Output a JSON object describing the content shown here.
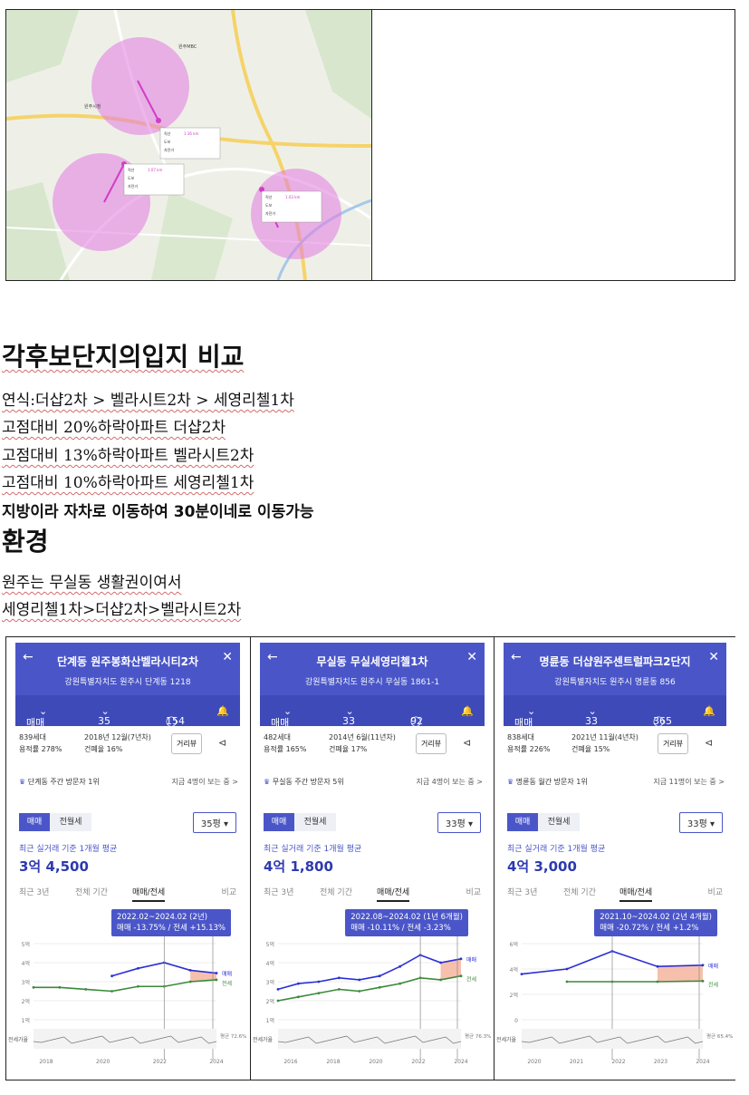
{
  "map": {
    "labels": {
      "city_hall": "원주시청",
      "mbc": "원주MBC",
      "popup": {
        "straight_label": "직선",
        "walk_label": "도보",
        "bike_label": "자전거"
      },
      "distances": [
        "1.36 km",
        "1.07 km",
        "1.03 km"
      ]
    },
    "colors": {
      "circle": "#e27ae0",
      "route": "#d23cc6",
      "road": "#f6d36a",
      "water": "#a6c8e8"
    }
  },
  "section1": {
    "heading": "각후보단지의입지 비교",
    "lines": [
      "연식:더샵2차 > 벨라시트2차 > 세영리첼1차",
      "고점대비 20%하락아파트 더샵2차",
      "고점대비 13%하락아파트 벨라시트2차",
      "고점대비 10%하락아파트 세영리첼1차"
    ],
    "bold_line": "지방이라 자차로 이동하여 30분이네로 이동가능"
  },
  "section2": {
    "heading": "환경",
    "lines": [
      "원주는 무실동 생활권이여서",
      "세영리첼1차>더샵2차>벨라시트2차"
    ]
  },
  "panels": [
    {
      "title": "단계동 원주봉화산벨라시티2차",
      "address": "강원특별자치도 원주시 단계동 1218",
      "bar": {
        "trade": "매매",
        "size": "35평",
        "comments": "154"
      },
      "households": "839세대",
      "floor_ratio": "용적률 278%",
      "built": "2018년 12월(7년차)",
      "coverage": "건폐율 16%",
      "distance_btn": "거리뷰",
      "rank": "단계동 주간 방문자 1위",
      "viewing": "지금 4명이 보는 중 >",
      "toggle_on": "매매",
      "toggle_off": "전월세",
      "select": "35평 ▾",
      "sub": "최근 실거래 기준 1개월 평균",
      "price": "3억 4,500",
      "tabs": [
        "최근 3년",
        "전체 기간",
        "매매/전세",
        "비교"
      ],
      "tip_line1": "2022.02~2024.02 (2년)",
      "tip_line2": "매매 -13.75% / 전세 +15.13%",
      "y_labels": [
        "5억",
        "4억",
        "3억",
        "2억",
        "1억"
      ],
      "x_labels": [
        "2018",
        "2020",
        "2022",
        "2024"
      ],
      "ratio_label": "전세가율",
      "ratio_value": "평균 72.6%",
      "legend_sale": "매매",
      "legend_jeonse": "전세",
      "chart_data": {
        "type": "line",
        "x": [
          "2017",
          "2018",
          "2019",
          "2020",
          "2021",
          "2022",
          "2023",
          "2024"
        ],
        "series": [
          {
            "name": "매매",
            "values": [
              null,
              null,
              null,
              3.3,
              3.7,
              4.0,
              3.6,
              3.45
            ]
          },
          {
            "name": "전세",
            "values": [
              2.7,
              2.7,
              2.6,
              2.5,
              2.75,
              2.75,
              3.0,
              3.1
            ]
          }
        ],
        "ylabel": "",
        "ylim": [
          1,
          5
        ]
      }
    },
    {
      "title": "무실동 무실세영리첼1차",
      "address": "강원특별자치도 원주시 무실동 1861-1",
      "bar": {
        "trade": "매매",
        "size": "33평",
        "comments": "92"
      },
      "households": "482세대",
      "floor_ratio": "용적률 165%",
      "built": "2014년 6월(11년차)",
      "coverage": "건폐율 17%",
      "distance_btn": "거리뷰",
      "rank": "무실동 주간 방문자 5위",
      "viewing": "지금 4명이 보는 중 >",
      "toggle_on": "매매",
      "toggle_off": "전월세",
      "select": "33평 ▾",
      "sub": "최근 실거래 기준 1개월 평균",
      "price": "4억 1,800",
      "tabs": [
        "최근 3년",
        "전체 기간",
        "매매/전세",
        "비교"
      ],
      "tip_line1": "2022.08~2024.02 (1년 6개월)",
      "tip_line2": "매매 -10.11% / 전세 -3.23%",
      "y_labels": [
        "5억",
        "4억",
        "3억",
        "2억",
        "1억"
      ],
      "x_labels": [
        "2016",
        "2018",
        "2020",
        "2022",
        "2024"
      ],
      "ratio_label": "전세가율",
      "ratio_value": "평균 76.3%",
      "legend_sale": "매매",
      "legend_jeonse": "전세",
      "chart_data": {
        "type": "line",
        "x": [
          "2015",
          "2016",
          "2017",
          "2018",
          "2019",
          "2020",
          "2021",
          "2022",
          "2023",
          "2024"
        ],
        "series": [
          {
            "name": "매매",
            "values": [
              2.6,
              2.9,
              3.0,
              3.2,
              3.1,
              3.3,
              3.8,
              4.4,
              4.0,
              4.2
            ]
          },
          {
            "name": "전세",
            "values": [
              2.0,
              2.2,
              2.4,
              2.6,
              2.5,
              2.7,
              2.9,
              3.2,
              3.1,
              3.3
            ]
          }
        ],
        "ylabel": "",
        "ylim": [
          1,
          5
        ]
      }
    },
    {
      "title": "명륜동 더샵원주센트럴파크2단지",
      "address": "강원특별자치도 원주시 명륜동 856",
      "bar": {
        "trade": "매매",
        "size": "33평",
        "comments": "365"
      },
      "households": "838세대",
      "floor_ratio": "용적률 226%",
      "built": "2021년 11월(4년차)",
      "coverage": "건폐율 15%",
      "distance_btn": "거리뷰",
      "rank": "명륜동 월간 방문자 1위",
      "viewing": "지금 11명이 보는 중 >",
      "toggle_on": "매매",
      "toggle_off": "전월세",
      "select": "33평 ▾",
      "sub": "최근 실거래 기준 1개월 평균",
      "price": "4억 3,000",
      "tabs": [
        "최근 3년",
        "전체 기간",
        "매매/전세",
        "비교"
      ],
      "tip_line1": "2021.10~2024.02 (2년 4개월)",
      "tip_line2": "매매 -20.72% / 전세 +1.2%",
      "y_labels": [
        "6억",
        "4억",
        "2억",
        "0"
      ],
      "x_labels": [
        "2020",
        "2021",
        "2022",
        "2023",
        "2024"
      ],
      "ratio_label": "전세가율",
      "ratio_value": "평균 65.4%",
      "legend_sale": "매매",
      "legend_jeonse": "전세",
      "chart_data": {
        "type": "line",
        "x": [
          "2020",
          "2021",
          "2022",
          "2023",
          "2024"
        ],
        "series": [
          {
            "name": "매매",
            "values": [
              3.6,
              4.0,
              5.4,
              4.2,
              4.3
            ]
          },
          {
            "name": "전세",
            "values": [
              null,
              3.0,
              3.0,
              3.0,
              3.05
            ]
          }
        ],
        "ylabel": "",
        "ylim": [
          0,
          6
        ]
      }
    }
  ]
}
